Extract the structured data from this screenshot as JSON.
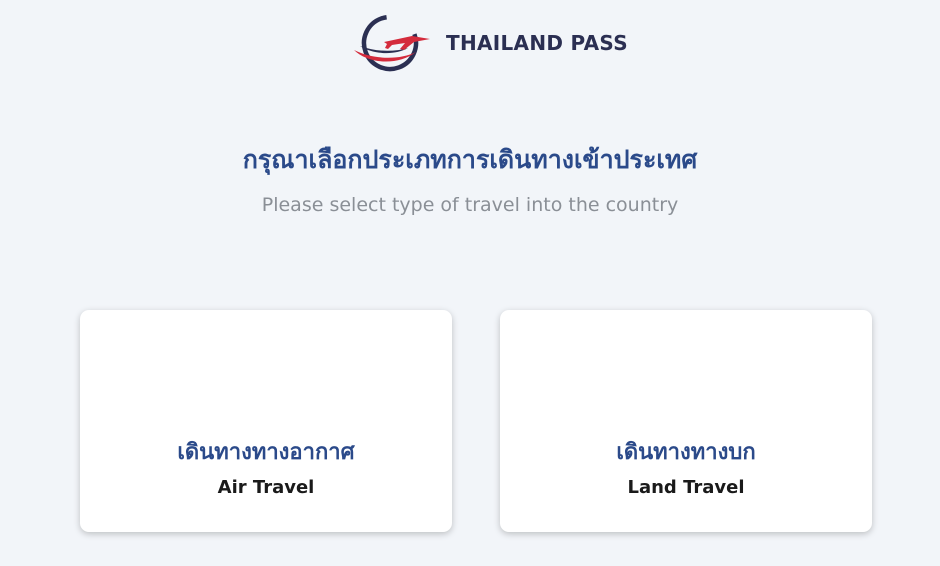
{
  "header": {
    "logo_text": "THAILAND PASS",
    "logo_icon": "thailand-pass-logo-icon"
  },
  "main": {
    "title_th": "กรุณาเลือกประเภทการเดินทางเข้าประเทศ",
    "subtitle_en": "Please select type of travel into the country"
  },
  "options": [
    {
      "label_th": "เดินทางทางอากาศ",
      "label_en": "Air Travel"
    },
    {
      "label_th": "เดินทางทางบก",
      "label_en": "Land Travel"
    }
  ],
  "colors": {
    "background": "#f2f5f9",
    "title": "#2b4a8a",
    "subtitle": "#8a8f96",
    "logo_dark": "#2b2f52",
    "logo_red": "#d42b3c"
  }
}
